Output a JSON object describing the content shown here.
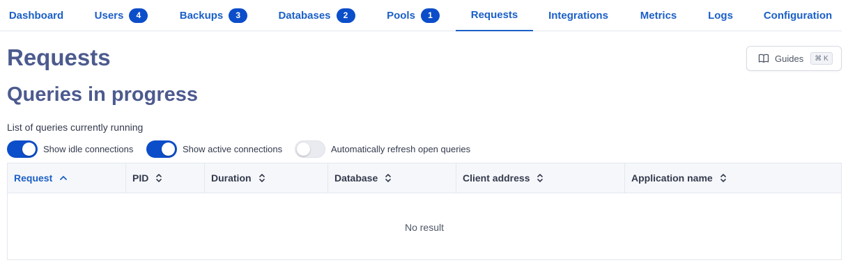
{
  "tabs": [
    {
      "label": "Dashboard",
      "badge": null
    },
    {
      "label": "Users",
      "badge": "4"
    },
    {
      "label": "Backups",
      "badge": "3"
    },
    {
      "label": "Databases",
      "badge": "2"
    },
    {
      "label": "Pools",
      "badge": "1"
    },
    {
      "label": "Requests",
      "badge": null,
      "active": true
    },
    {
      "label": "Integrations",
      "badge": null
    },
    {
      "label": "Metrics",
      "badge": null
    },
    {
      "label": "Logs",
      "badge": null
    },
    {
      "label": "Configuration",
      "badge": null
    }
  ],
  "page": {
    "title": "Requests",
    "section_title": "Queries in progress",
    "subtitle": "List of queries currently running"
  },
  "guides": {
    "label": "Guides",
    "shortcut": "⌘ K",
    "icon": "book-icon"
  },
  "toggles": [
    {
      "label": "Show idle connections",
      "on": true
    },
    {
      "label": "Show active connections",
      "on": true
    },
    {
      "label": "Automatically refresh open queries",
      "on": false
    }
  ],
  "table": {
    "columns": [
      {
        "label": "Request",
        "sort": "ascending"
      },
      {
        "label": "PID",
        "sort": "none"
      },
      {
        "label": "Duration",
        "sort": "none"
      },
      {
        "label": "Database",
        "sort": "none"
      },
      {
        "label": "Client address",
        "sort": "none"
      },
      {
        "label": "Application name",
        "sort": "none"
      }
    ],
    "empty_text": "No result"
  },
  "colors": {
    "accent": "#1b5fc7",
    "badge": "#0c4ec9",
    "heading": "#4c5a8e"
  }
}
